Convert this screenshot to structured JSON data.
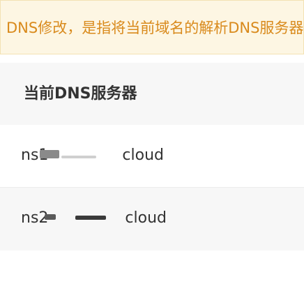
{
  "notice": {
    "text": "DNS修改，是指将当前域名的解析DNS服务器"
  },
  "dns_card": {
    "title": "当前DNS服务器",
    "servers": [
      {
        "label": "ns1",
        "suffix": "cloud"
      },
      {
        "label": "ns2",
        "suffix": "cloud"
      }
    ]
  },
  "colors": {
    "notice_text": "#d98a1c",
    "notice_bg": "#fdf6e3",
    "row_alt_bg": "#f7f7f7",
    "text_primary": "#333333"
  }
}
